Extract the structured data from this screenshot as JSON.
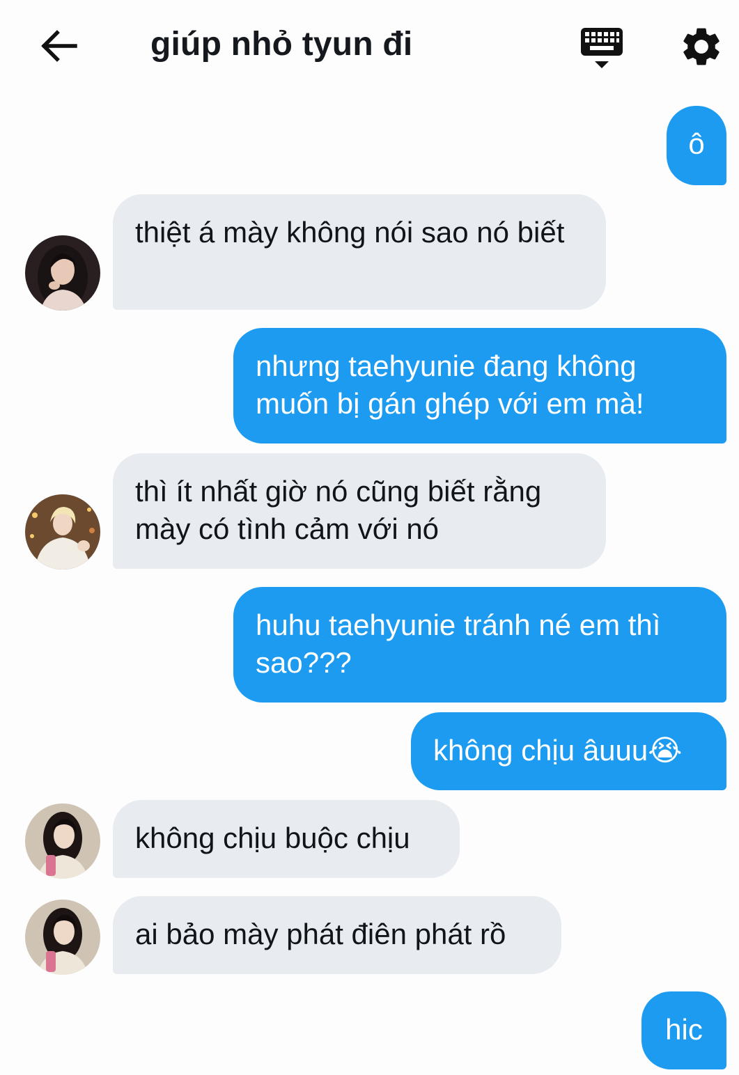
{
  "header": {
    "title": "giúp nhỏ tyun đi"
  },
  "icons": {
    "back": "arrow-left-icon",
    "keyboard": "keyboard-icon",
    "settings": "gear-icon"
  },
  "colors": {
    "outgoing_bubble": "#1d9bf0",
    "incoming_bubble": "#e8ebef",
    "background": "#fdfdfe"
  },
  "messages": [
    {
      "direction": "out",
      "text": "ô"
    },
    {
      "direction": "in",
      "text": "thiệt á mày không nói sao nó biết",
      "avatar": "avatar-girl-1"
    },
    {
      "direction": "out",
      "text": "nhưng taehyunie đang không muốn bị gán ghép với em mà!"
    },
    {
      "direction": "in",
      "text": "thì ít nhất giờ nó cũng biết rằng mày có tình cảm với nó",
      "avatar": "avatar-blond-boy"
    },
    {
      "direction": "out",
      "text": "huhu taehyunie tránh né em thì sao???"
    },
    {
      "direction": "out",
      "text": "không chịu âuuu😭"
    },
    {
      "direction": "in",
      "text": "không chịu buộc chịu",
      "avatar": "avatar-girl-2"
    },
    {
      "direction": "in",
      "text": "ai bảo mày phát điên phát rồ",
      "avatar": "avatar-girl-2"
    },
    {
      "direction": "out",
      "text": "hic"
    }
  ]
}
